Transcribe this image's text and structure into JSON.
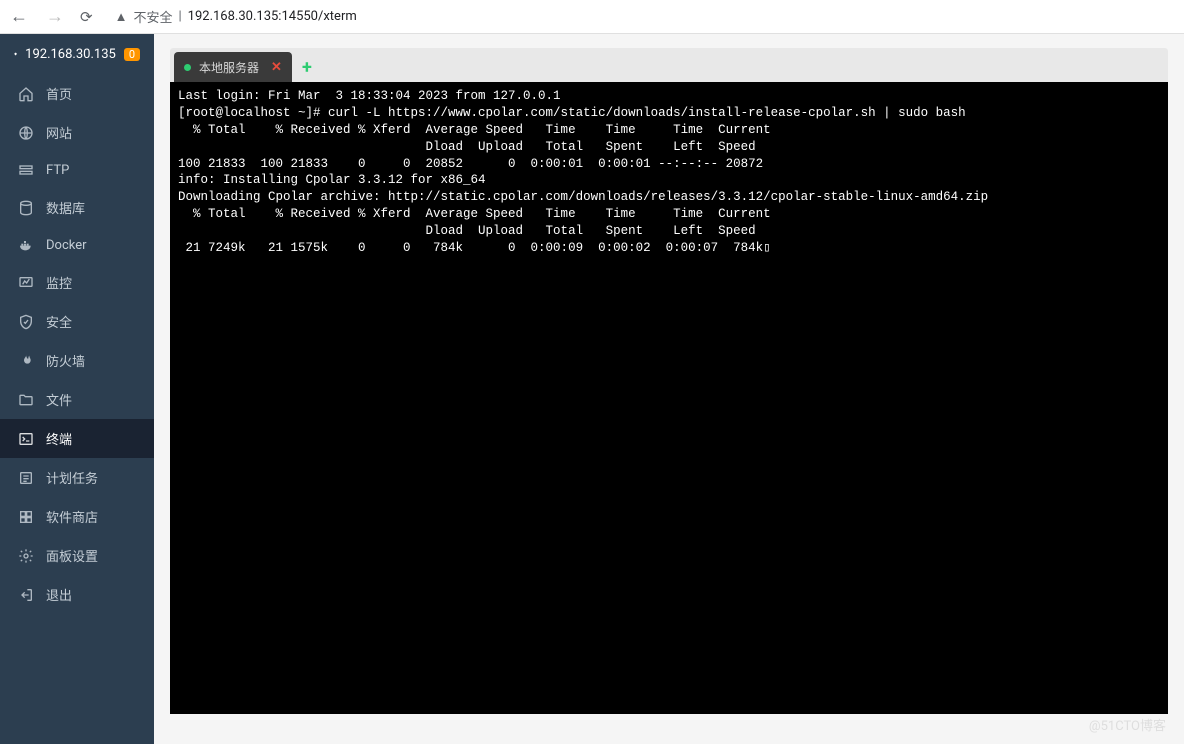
{
  "browser": {
    "insecure_label": "不安全",
    "url": "192.168.30.135:14550/xterm"
  },
  "sidebar": {
    "host": "192.168.30.135",
    "badge": "0",
    "items": [
      {
        "icon": "home",
        "label": "首页"
      },
      {
        "icon": "globe",
        "label": "网站"
      },
      {
        "icon": "ftp",
        "label": "FTP"
      },
      {
        "icon": "db",
        "label": "数据库"
      },
      {
        "icon": "docker",
        "label": "Docker"
      },
      {
        "icon": "monitor",
        "label": "监控"
      },
      {
        "icon": "shield",
        "label": "安全"
      },
      {
        "icon": "fire",
        "label": "防火墙"
      },
      {
        "icon": "folder",
        "label": "文件"
      },
      {
        "icon": "terminal",
        "label": "终端"
      },
      {
        "icon": "cron",
        "label": "计划任务"
      },
      {
        "icon": "store",
        "label": "软件商店"
      },
      {
        "icon": "gear",
        "label": "面板设置"
      },
      {
        "icon": "exit",
        "label": "退出"
      }
    ],
    "active_index": 9
  },
  "tabs": {
    "active_label": "本地服务器"
  },
  "terminal": {
    "lines": [
      "Last login: Fri Mar  3 18:33:04 2023 from 127.0.0.1",
      "[root@localhost ~]# curl -L https://www.cpolar.com/static/downloads/install-release-cpolar.sh | sudo bash",
      "  % Total    % Received % Xferd  Average Speed   Time    Time     Time  Current",
      "                                 Dload  Upload   Total   Spent    Left  Speed",
      "100 21833  100 21833    0     0  20852      0  0:00:01  0:00:01 --:--:-- 20872",
      "info: Installing Cpolar 3.3.12 for x86_64",
      "Downloading Cpolar archive: http://static.cpolar.com/downloads/releases/3.3.12/cpolar-stable-linux-amd64.zip",
      "  % Total    % Received % Xferd  Average Speed   Time    Time     Time  Current",
      "                                 Dload  Upload   Total   Spent    Left  Speed",
      " 21 7249k   21 1575k    0     0   784k      0  0:00:09  0:00:02  0:00:07  784k▯"
    ]
  },
  "watermark": "@51CTO博客"
}
